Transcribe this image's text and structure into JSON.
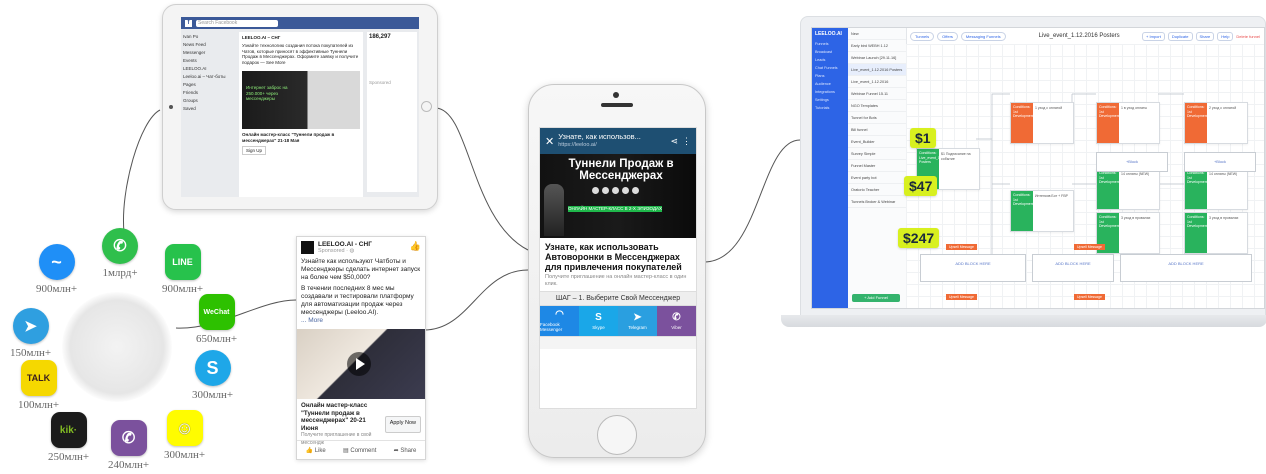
{
  "apps": [
    {
      "key": "messenger",
      "label": "",
      "count": "900млн+",
      "color": "#1f8ff7",
      "icon": "messenger-icon",
      "glyph": "~"
    },
    {
      "key": "whatsapp",
      "label": "",
      "count": "1млрд+",
      "color": "#2fbf4c",
      "icon": "whatsapp-icon",
      "glyph": "✆"
    },
    {
      "key": "line",
      "label": "LINE",
      "count": "900млн+",
      "color": "#27c24c",
      "icon": "line-icon",
      "glyph": ""
    },
    {
      "key": "telegram",
      "label": "",
      "count": "150млн+",
      "color": "#2f9fe0",
      "icon": "telegram-icon",
      "glyph": "➤"
    },
    {
      "key": "wechat",
      "label": "WeChat",
      "count": "650млн+",
      "color": "#2dc100",
      "icon": "wechat-icon",
      "glyph": ""
    },
    {
      "key": "kakaotalk",
      "label": "TALK",
      "count": "100млн+",
      "color": "#f5d800",
      "icon": "kakaotalk-icon",
      "glyph": ""
    },
    {
      "key": "skype",
      "label": "S",
      "count": "300млн+",
      "color": "#1ea7e8",
      "icon": "skype-icon",
      "glyph": ""
    },
    {
      "key": "kik",
      "label": "kik·",
      "count": "250млн+",
      "color": "#1b1b1b",
      "icon": "kik-icon",
      "glyph": ""
    },
    {
      "key": "viber",
      "label": "",
      "count": "240млн+",
      "color": "#7b519d",
      "icon": "viber-icon",
      "glyph": "✆"
    },
    {
      "key": "snapchat",
      "label": "",
      "count": "300млн+",
      "color": "#fffc00",
      "icon": "snapchat-icon",
      "glyph": "☺"
    }
  ],
  "tablet": {
    "search_placeholder": "Search Facebook",
    "sidebar": [
      "Ivan Po",
      "News Feed",
      "Messenger",
      "Events",
      "LEELOO.AI",
      "Leeloo.ai – Чат-боты",
      "Pages",
      "Friends",
      "Groups",
      "Saved"
    ],
    "post": {
      "page": "LEELOO.AI – СНГ",
      "text": "Узнайте технологию создания потока покупателей из Чатов, которые приносят в эффективные Туннели Продаж в Мессенджерах. Оформите заявку и получите подарок — See More",
      "image_text": "Интернет заброс на 250.000+ через мессенджеры",
      "headline": "Онлайн мастер-класс \"Туннели продаж в мессенджерах\" 21-18 Мая",
      "cta": "Sign Up"
    },
    "right": {
      "stat": "186,297",
      "label": "Sponsored"
    }
  },
  "ad_card": {
    "page": "LEELOO.AI - СНГ",
    "sponsored": "Sponsored · ◍",
    "text": "Узнайте как используют Чатботы и Мессенджеры сделать интернет запуск на более чем $50,000?",
    "text2": "В течении последних 8 мес мы создавали и тестировали платформу для автоматизации продаж через мессенджеры (Leeloo.AI).",
    "more": "... More",
    "headline": "Онлайн мастер-класс \"Туннели продаж в мессенджерах\" 20-21 Июня",
    "sub": "Получите приглашение в свой мессендж",
    "apply": "Apply Now",
    "like": "👍 Like",
    "comment": "▤ Comment",
    "share": "➦ Share"
  },
  "phone": {
    "title": "Узнате, как использов...",
    "url": "https://leeloo.ai/",
    "hero_title": "Туннели Продаж в Мессенджерах",
    "hero_band": "ОНЛАЙН МАСТЕР-КЛАСС В 2-Х ЭПИЗОДАХ",
    "headline": "Узнате, как использовать Автоворонки в Мессенджерах для привлечения покупателей",
    "sub": "Получите приглашение на онлайн мастер-класс в один клик.",
    "step": "ШАГ – 1. Выберите Свой Мессенджер",
    "buttons": [
      {
        "glyph": "◠",
        "label": "Facebook Messenger",
        "color": "#1e88e5"
      },
      {
        "glyph": "S",
        "label": "Skype",
        "color": "#1aa7e8"
      },
      {
        "glyph": "➤",
        "label": "Telegram",
        "color": "#2a9fe0"
      },
      {
        "glyph": "✆",
        "label": "Viber",
        "color": "#7b519d"
      }
    ]
  },
  "editor": {
    "brand": "LEELOO.AI",
    "side": [
      "Funnels",
      "Broadcast",
      "Leads",
      "Chat Funnels",
      "Plans",
      "Audience",
      "Integrations",
      "Settings",
      "Tutorials"
    ],
    "list": [
      "New",
      "Import",
      "Early bird WEBH 1.12",
      "Webinar Launch [29.11.16]",
      "Live_event_1.12.2016 Posters",
      "Live_event_1.12.2016",
      "Webinar Funnel 15.11",
      "NGO Templates",
      "Tunnel for Bots",
      "Bill funnel",
      "Event_Builder",
      "Survey Simple",
      "Funnel Master",
      "Event party bot",
      "Oratorio Teacher",
      "Tunnels Broker & Webinar"
    ],
    "add_button": "+ Add Funnel",
    "tabs": [
      "Tunnels",
      "Offers",
      "Messaging Funnels"
    ],
    "title": "Live_event_1.12.2016 Posters",
    "tools": [
      "+ Import",
      "Duplicate",
      "Share",
      "Help"
    ],
    "delete": "Delete funnel",
    "prices": [
      "$1",
      "$47",
      "$247"
    ],
    "nodes": [
      {
        "head": "Conditions: 1st Development",
        "text": "1 уход с оплатой",
        "color": "orange"
      },
      {
        "head": "Conditions: 1st Development",
        "text": "1 в уход оплаты",
        "color": "orange"
      },
      {
        "head": "Conditions: 1st Development",
        "text": "2 уход с оплатой",
        "color": "orange"
      },
      {
        "head": "Conditions: Live_event_1.12.2016 Posters",
        "text": "$1 Подписание на событие",
        "color": "green"
      },
      {
        "head": "Conditions: 1st Development",
        "text": "Интенсив Бот + FBP",
        "color": "green"
      },
      {
        "head": "Conditions: 1st Development",
        "text": "14 оплаты (NEW)",
        "color": "green"
      },
      {
        "head": "Conditions: 1st Development",
        "text": "3 уход в провалах",
        "color": "green"
      },
      {
        "head": "Conditions: 1st Development",
        "text": "14 оплаты (NEW)",
        "color": "green"
      },
      {
        "head": "Conditions: 1st Development",
        "text": "3 уход в провалах",
        "color": "green"
      }
    ],
    "placeholders": [
      "+Block",
      "+Block",
      "ADD BLOCK HERE",
      "ADD BLOCK HERE",
      "ADD BLOCK HERE"
    ],
    "tags": [
      "Upsell Message",
      "Upsell Message",
      "Upsell Message",
      "Upsell Message"
    ]
  }
}
